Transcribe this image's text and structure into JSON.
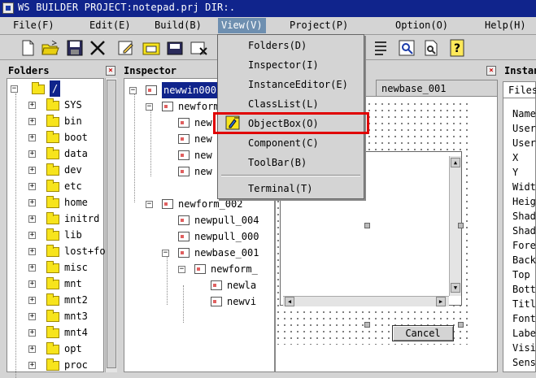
{
  "window": {
    "title": "WS BUILDER PROJECT:notepad.prj DIR:."
  },
  "menubar": [
    {
      "label": "File(F)",
      "active": false
    },
    {
      "label": "Edit(E)",
      "active": false
    },
    {
      "label": "Build(B)",
      "active": false
    },
    {
      "label": "View(V)",
      "active": true
    },
    {
      "label": "Project(P)",
      "active": false
    },
    {
      "label": "Option(O)",
      "active": false
    },
    {
      "label": "Help(H)",
      "active": false
    }
  ],
  "toolbar": {
    "icons": [
      "new-file-icon",
      "open-folder-icon",
      "save-icon",
      "cut-icon",
      "edit-icon",
      "open-project-icon",
      "save-project-icon",
      "close-project-icon",
      "list-icon",
      "inspect-icon",
      "preview-icon",
      "help-icon"
    ]
  },
  "view_menu": {
    "items": [
      "Folders(D)",
      "Inspector(I)",
      "InstanceEditor(E)",
      "ClassList(L)",
      "ObjectBox(O)",
      "Component(C)",
      "ToolBar(B)",
      "Terminal(T)"
    ],
    "highlighted": "ObjectBox(O)"
  },
  "folders_panel": {
    "title": "Folders",
    "close": "×",
    "root": "/",
    "items": [
      "SYS",
      "bin",
      "boot",
      "data",
      "dev",
      "etc",
      "home",
      "initrd",
      "lib",
      "lost+fou",
      "misc",
      "mnt",
      "mnt2",
      "mnt3",
      "mnt4",
      "opt",
      "proc"
    ]
  },
  "inspector_panel": {
    "title": "Inspector",
    "close": "×",
    "root": "newwin000",
    "nodes": {
      "form1": "newform",
      "form1_children": [
        "new",
        "new",
        "new",
        "new"
      ],
      "form2": "newform_002",
      "pull1": "newpull_004",
      "pull2": "newpull_000",
      "base": "newbase_001",
      "form3": "newform_",
      "leaf1": "newla",
      "leaf2": "newvi"
    }
  },
  "designer": {
    "tab": "newbase_001",
    "cancel_label": "Cancel"
  },
  "instance_panel": {
    "title": "Instan",
    "close": "×",
    "tab": "Files",
    "properties": [
      "Name",
      "User",
      "User",
      "X",
      "Y",
      "Widt",
      "Heig",
      "Shad",
      "Shad",
      "Fore",
      "Back",
      "Top",
      "Bott",
      "Titl",
      "Font",
      "Labe",
      "Visi",
      "Sens"
    ]
  },
  "colors": {
    "titlebar": "#10248c",
    "menu_active": "#6e8fb0",
    "highlight_box": "#e00000",
    "folder": "#f7e41c"
  }
}
